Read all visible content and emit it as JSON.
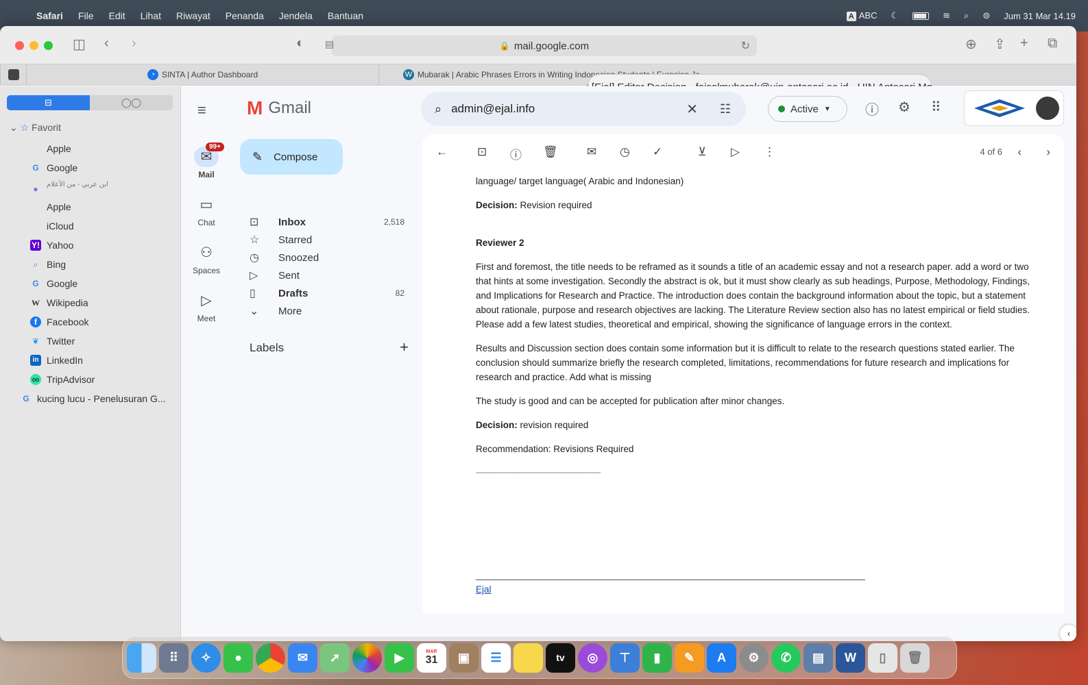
{
  "menubar": {
    "apple": "",
    "items": [
      "Safari",
      "File",
      "Edit",
      "Lihat",
      "Riwayat",
      "Penanda",
      "Jendela",
      "Bantuan"
    ],
    "input_source": "ABC",
    "input_badge": "A",
    "datetime": "Jum 31 Mar  14.19"
  },
  "browser": {
    "url": "mail.google.com",
    "tabs": [
      {
        "title": "SINTA | Author Dashboard",
        "color": "#1a73e8"
      },
      {
        "title": "Mubarak | Arabic Phrases Errors in Writing Indonesian Students | Eurasian Jo...",
        "color": "#21759b"
      },
      {
        "title": "[Ejal] Editor Decision - faisalmubarak@uin-antasari.ac.id - UIN Antasari Mail",
        "color": "#666666"
      }
    ]
  },
  "sidebar": {
    "favorites_label": "Favorit",
    "bookmarks": [
      {
        "label": "Apple",
        "icon": "apple-icon"
      },
      {
        "label": "Google",
        "icon": "google-icon"
      },
      {
        "label": "ابن عربي - من الأعلام",
        "icon": "globe-icon"
      },
      {
        "label": "Apple",
        "icon": "apple-icon"
      },
      {
        "label": "iCloud",
        "icon": "apple-icon"
      },
      {
        "label": "Yahoo",
        "icon": "yahoo-icon"
      },
      {
        "label": "Bing",
        "icon": "bing-icon"
      },
      {
        "label": "Google",
        "icon": "google-icon"
      },
      {
        "label": "Wikipedia",
        "icon": "wikipedia-icon"
      },
      {
        "label": "Facebook",
        "icon": "facebook-icon"
      },
      {
        "label": "Twitter",
        "icon": "twitter-icon"
      },
      {
        "label": "LinkedIn",
        "icon": "linkedin-icon"
      },
      {
        "label": "TripAdvisor",
        "icon": "tripadvisor-icon"
      }
    ],
    "extra_item": "kucing lucu - Penelusuran G..."
  },
  "gmail": {
    "logo": "Gmail",
    "rail": {
      "mail": "Mail",
      "mail_badge": "99+",
      "chat": "Chat",
      "spaces": "Spaces",
      "meet": "Meet"
    },
    "compose": "Compose",
    "nav": [
      {
        "label": "Inbox",
        "count": "2,518",
        "bold": true,
        "icon": "inbox-icon"
      },
      {
        "label": "Starred",
        "count": "",
        "bold": false,
        "icon": "star-icon"
      },
      {
        "label": "Snoozed",
        "count": "",
        "bold": false,
        "icon": "clock-icon"
      },
      {
        "label": "Sent",
        "count": "",
        "bold": false,
        "icon": "send-icon"
      },
      {
        "label": "Drafts",
        "count": "82",
        "bold": true,
        "icon": "draft-icon"
      },
      {
        "label": "More",
        "count": "",
        "bold": false,
        "icon": "chevron-down-icon"
      }
    ],
    "labels_heading": "Labels",
    "search_value": "admin@ejal.info",
    "status": "Active",
    "pagination": "4 of 6"
  },
  "email": {
    "intro_line": "language/ target language( Arabic and Indonesian)",
    "decision1_label": "Decision:",
    "decision1_value": " Revision required",
    "reviewer_heading": "Reviewer 2",
    "paragraph1": "First and foremost, the title needs to be reframed as it sounds a title of an academic essay and not a research paper. add a word or two that hints at some investigation. Secondly the abstract is ok, but it must show clearly as sub headings, Purpose, Methodology, Findings, and Implications for Research and Practice. The introduction does contain the background information about the topic, but a statement about rationale, purpose and research objectives are lacking. The Literature Review section also has no latest empirical or field studies. Please add a few latest studies, theoretical and empirical, showing the significance of language errors in the context.",
    "paragraph2": "Results and Discussion section does contain some information but it is difficult to relate to the research questions stated earlier. The conclusion should summarize briefly the research completed, limitations, recommendations for future research and implications for research and practice. Add what is missing",
    "paragraph3": "The study is good and can be accepted for publication after minor changes.",
    "decision2_label": "Decision:",
    "decision2_value": " revision required",
    "recommendation": "Recommendation: Revisions Required",
    "separator": "------------------------------------------------------------------------------",
    "signature_link": "Ejal"
  },
  "dock": {
    "calendar_month": "MAR",
    "calendar_day": "31",
    "tv_label": "tv"
  }
}
